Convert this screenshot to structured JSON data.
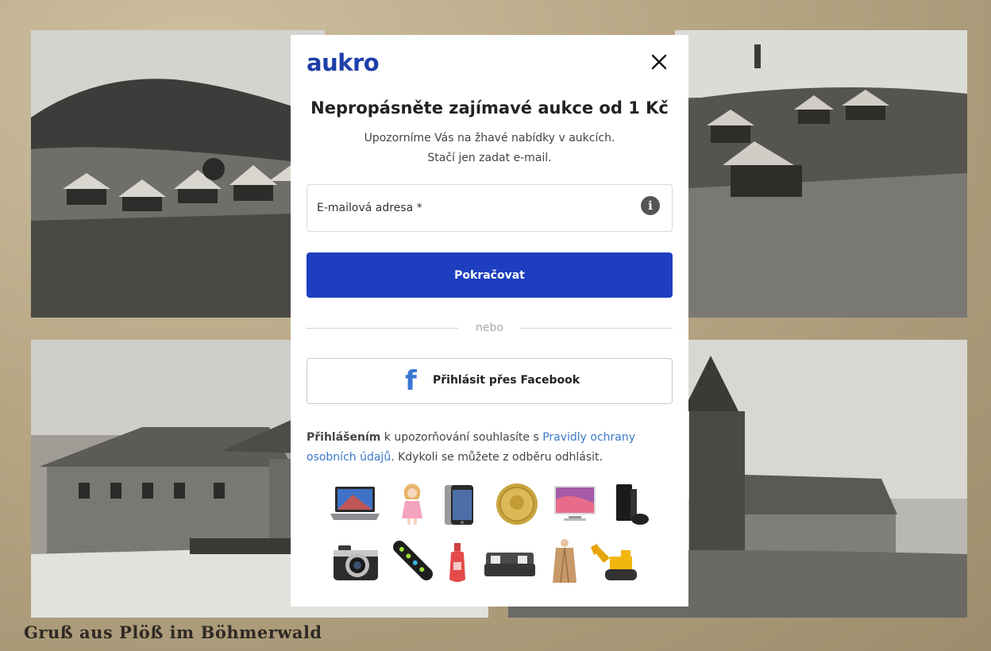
{
  "background": {
    "caption": "Gruß aus Plöß im Böhmerwald"
  },
  "modal": {
    "logo": "aukro",
    "close_icon": "close-icon",
    "headline": "Nepropásněte zajímavé aukce od 1 Kč",
    "sub_line1": "Upozorníme Vás na žhavé nabídky v aukcích.",
    "sub_line2": "Stačí jen zadat e-mail.",
    "email": {
      "placeholder": "E-mailová adresa *",
      "value": "",
      "info_icon": "info-icon"
    },
    "continue_label": "Pokračovat",
    "divider_text": "nebo",
    "facebook": {
      "icon": "facebook-icon",
      "label": "Přihlásit přes Facebook"
    },
    "consent": {
      "bold": "Přihlášením",
      "text1": " k upozorňování souhlasíte s ",
      "link": "Pravidly ochrany osobních údajů",
      "text2": ". Kdykoli se můžete z odběru odhlásit."
    },
    "product_icons": [
      "laptop-icon",
      "doll-icon",
      "smartphone-icon",
      "gold-coin-icon",
      "television-icon",
      "game-console-icon",
      "camera-icon",
      "skateboard-icon",
      "perfume-icon",
      "sofa-icon",
      "coat-icon",
      "toy-excavator-icon"
    ]
  },
  "colors": {
    "brand": "#1d3fa8",
    "button": "#1d3fbf",
    "link": "#3a78c9",
    "facebook": "#3a77d4"
  }
}
